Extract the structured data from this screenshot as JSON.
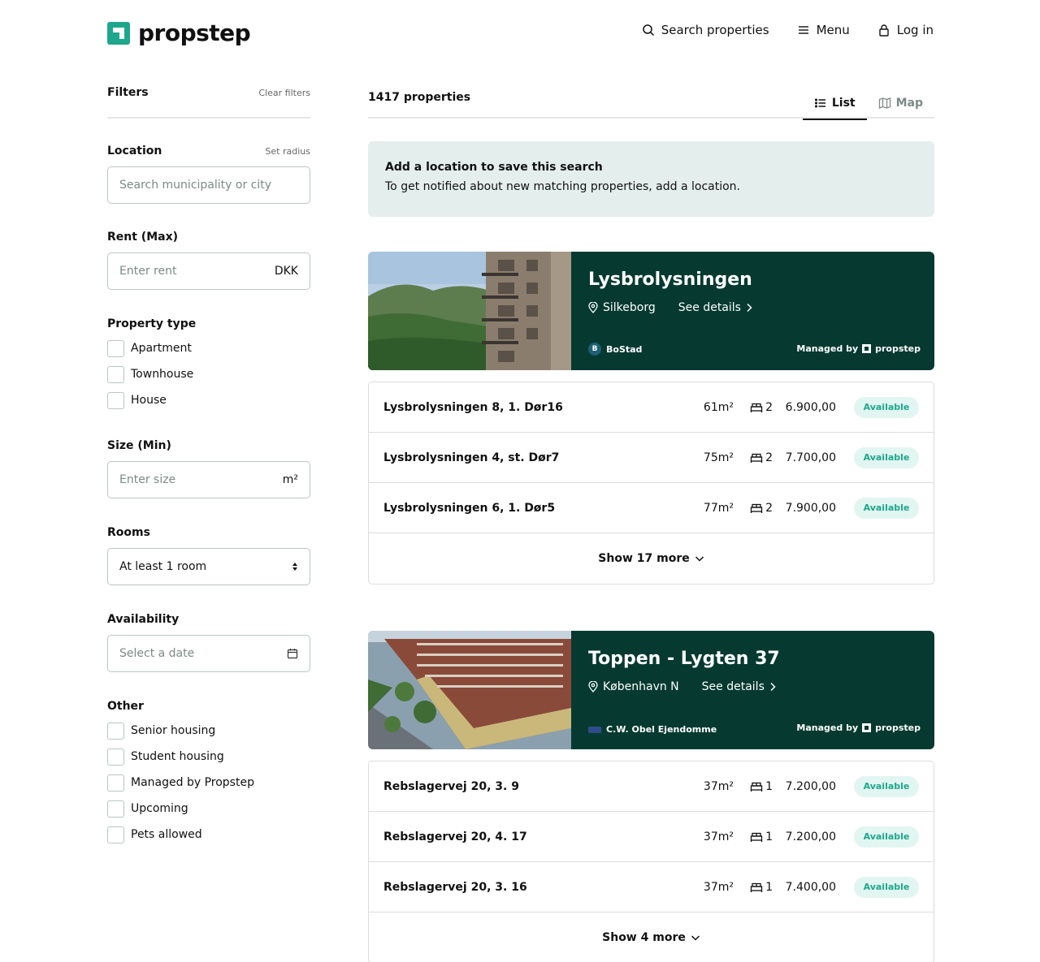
{
  "header": {
    "logo_text": "propstep",
    "nav": {
      "search": "Search properties",
      "menu": "Menu",
      "login": "Log in"
    }
  },
  "sidebar": {
    "title": "Filters",
    "clear": "Clear filters",
    "location": {
      "label": "Location",
      "link": "Set radius",
      "placeholder": "Search municipality or city"
    },
    "rent": {
      "label": "Rent (Max)",
      "placeholder": "Enter rent",
      "suffix": "DKK"
    },
    "property_type": {
      "label": "Property type",
      "options": [
        "Apartment",
        "Townhouse",
        "House"
      ]
    },
    "size": {
      "label": "Size (Min)",
      "placeholder": "Enter size",
      "suffix": "m²"
    },
    "rooms": {
      "label": "Rooms",
      "value": "At least 1 room"
    },
    "availability": {
      "label": "Availability",
      "placeholder": "Select a date"
    },
    "other": {
      "label": "Other",
      "options": [
        "Senior housing",
        "Student housing",
        "Managed by Propstep",
        "Upcoming",
        "Pets allowed"
      ]
    }
  },
  "main": {
    "count": "1417 properties",
    "tabs": {
      "list": "List",
      "map": "Map"
    },
    "notice": {
      "title": "Add a location to save this search",
      "text": "To get notified about new matching properties, add a location."
    },
    "properties": [
      {
        "name": "Lysbrolysningen",
        "location": "Silkeborg",
        "details": "See details",
        "landlord": "BoStad",
        "managed_by": "Managed by",
        "managed_brand": "propstep",
        "units": [
          {
            "address": "Lysbrolysningen 8, 1. Dør16",
            "size": "61m²",
            "rooms": "2",
            "price": "6.900,00",
            "status": "Available"
          },
          {
            "address": "Lysbrolysningen 4, st. Dør7",
            "size": "75m²",
            "rooms": "2",
            "price": "7.700,00",
            "status": "Available"
          },
          {
            "address": "Lysbrolysningen 6, 1. Dør5",
            "size": "77m²",
            "rooms": "2",
            "price": "7.900,00",
            "status": "Available"
          }
        ],
        "show_more": "Show 17 more"
      },
      {
        "name": "Toppen - Lygten 37",
        "location": "København N",
        "details": "See details",
        "landlord": "C.W. Obel Ejendomme",
        "managed_by": "Managed by",
        "managed_brand": "propstep",
        "units": [
          {
            "address": "Rebslagervej 20, 3. 9",
            "size": "37m²",
            "rooms": "1",
            "price": "7.200,00",
            "status": "Available"
          },
          {
            "address": "Rebslagervej 20, 4. 17",
            "size": "37m²",
            "rooms": "1",
            "price": "7.200,00",
            "status": "Available"
          },
          {
            "address": "Rebslagervej 20, 3. 16",
            "size": "37m²",
            "rooms": "1",
            "price": "7.400,00",
            "status": "Available"
          }
        ],
        "show_more": "Show 4 more"
      }
    ]
  },
  "colors": {
    "brand": "#1ea78c",
    "card_dark": "#063a31",
    "notice_bg": "#e4eeed",
    "badge_bg": "#e2f6f1"
  }
}
